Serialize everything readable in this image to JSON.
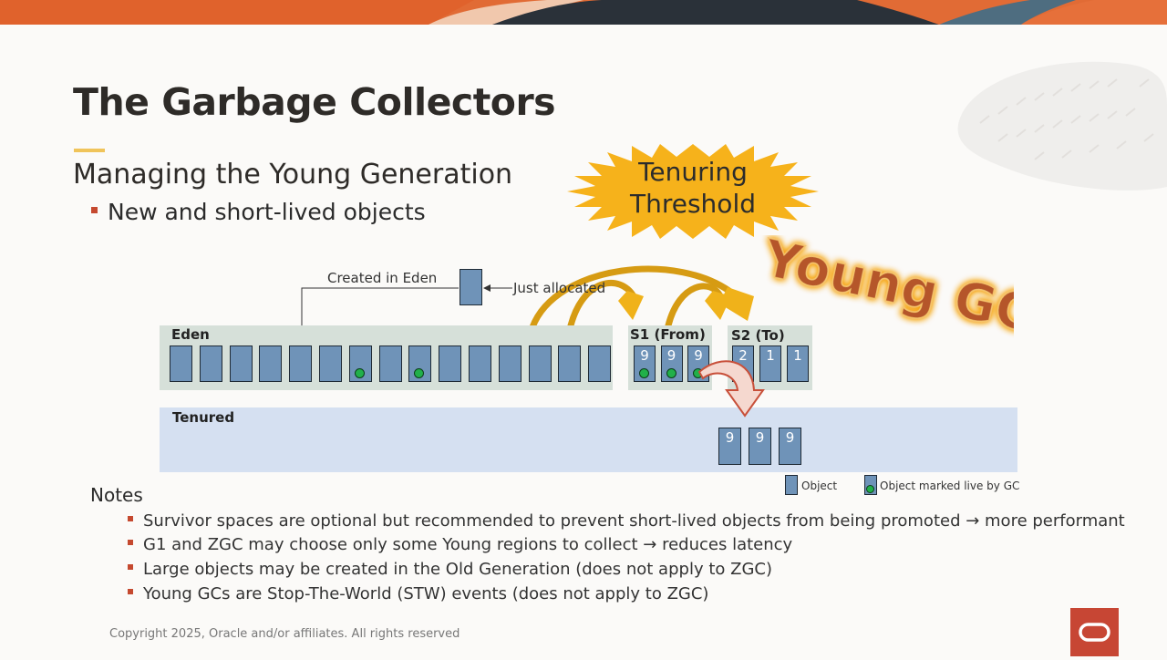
{
  "slide": {
    "title": "The Garbage Collectors",
    "subtitle": "Managing the Young Generation",
    "bullet": "New and short-lived objects",
    "notes_title": "Notes",
    "notes": [
      "Survivor spaces are optional but recommended to prevent short-lived objects from being promoted → more performant",
      "G1 and ZGC may choose only some Young regions to collect → reduces latency",
      "Large objects may be created in the Old Generation (does not apply to ZGC)",
      "Young GCs are Stop-The-World (STW) events (does not apply to ZGC)"
    ],
    "copyright": "Copyright 2025, Oracle and/or affiliates. All rights reserved"
  },
  "diagram": {
    "eden_label": "Eden",
    "s1_label": "S1 (From)",
    "s2_label": "S2 (To)",
    "tenured_label": "Tenured",
    "created_label": "Created in Eden",
    "just_allocated_label": "Just allocated",
    "burst_line1": "Tenuring",
    "burst_line2": "Threshold",
    "young_gc_label": "Young GC",
    "eden_live_flags": [
      false,
      false,
      false,
      false,
      false,
      false,
      true,
      false,
      true,
      false,
      false,
      false,
      false,
      false,
      false
    ],
    "s1_ages": [
      "9",
      "9",
      "9"
    ],
    "s2_ages": [
      "2",
      "1",
      "1"
    ],
    "tenured_ages": [
      "9",
      "9",
      "9"
    ],
    "legend_object": "Object",
    "legend_live": "Object marked live by GC"
  },
  "colors": {
    "object_fill": "#6f93b8",
    "live_marker": "#21b04a",
    "young_region": "#d6e0d9",
    "tenured_region": "#d5e0f1",
    "burst": "#f6b21b",
    "young_gc_text": "#b5562a",
    "arrows": "#d69b13",
    "accent_bullet": "#c5492f",
    "oracle_red": "#c74634"
  }
}
